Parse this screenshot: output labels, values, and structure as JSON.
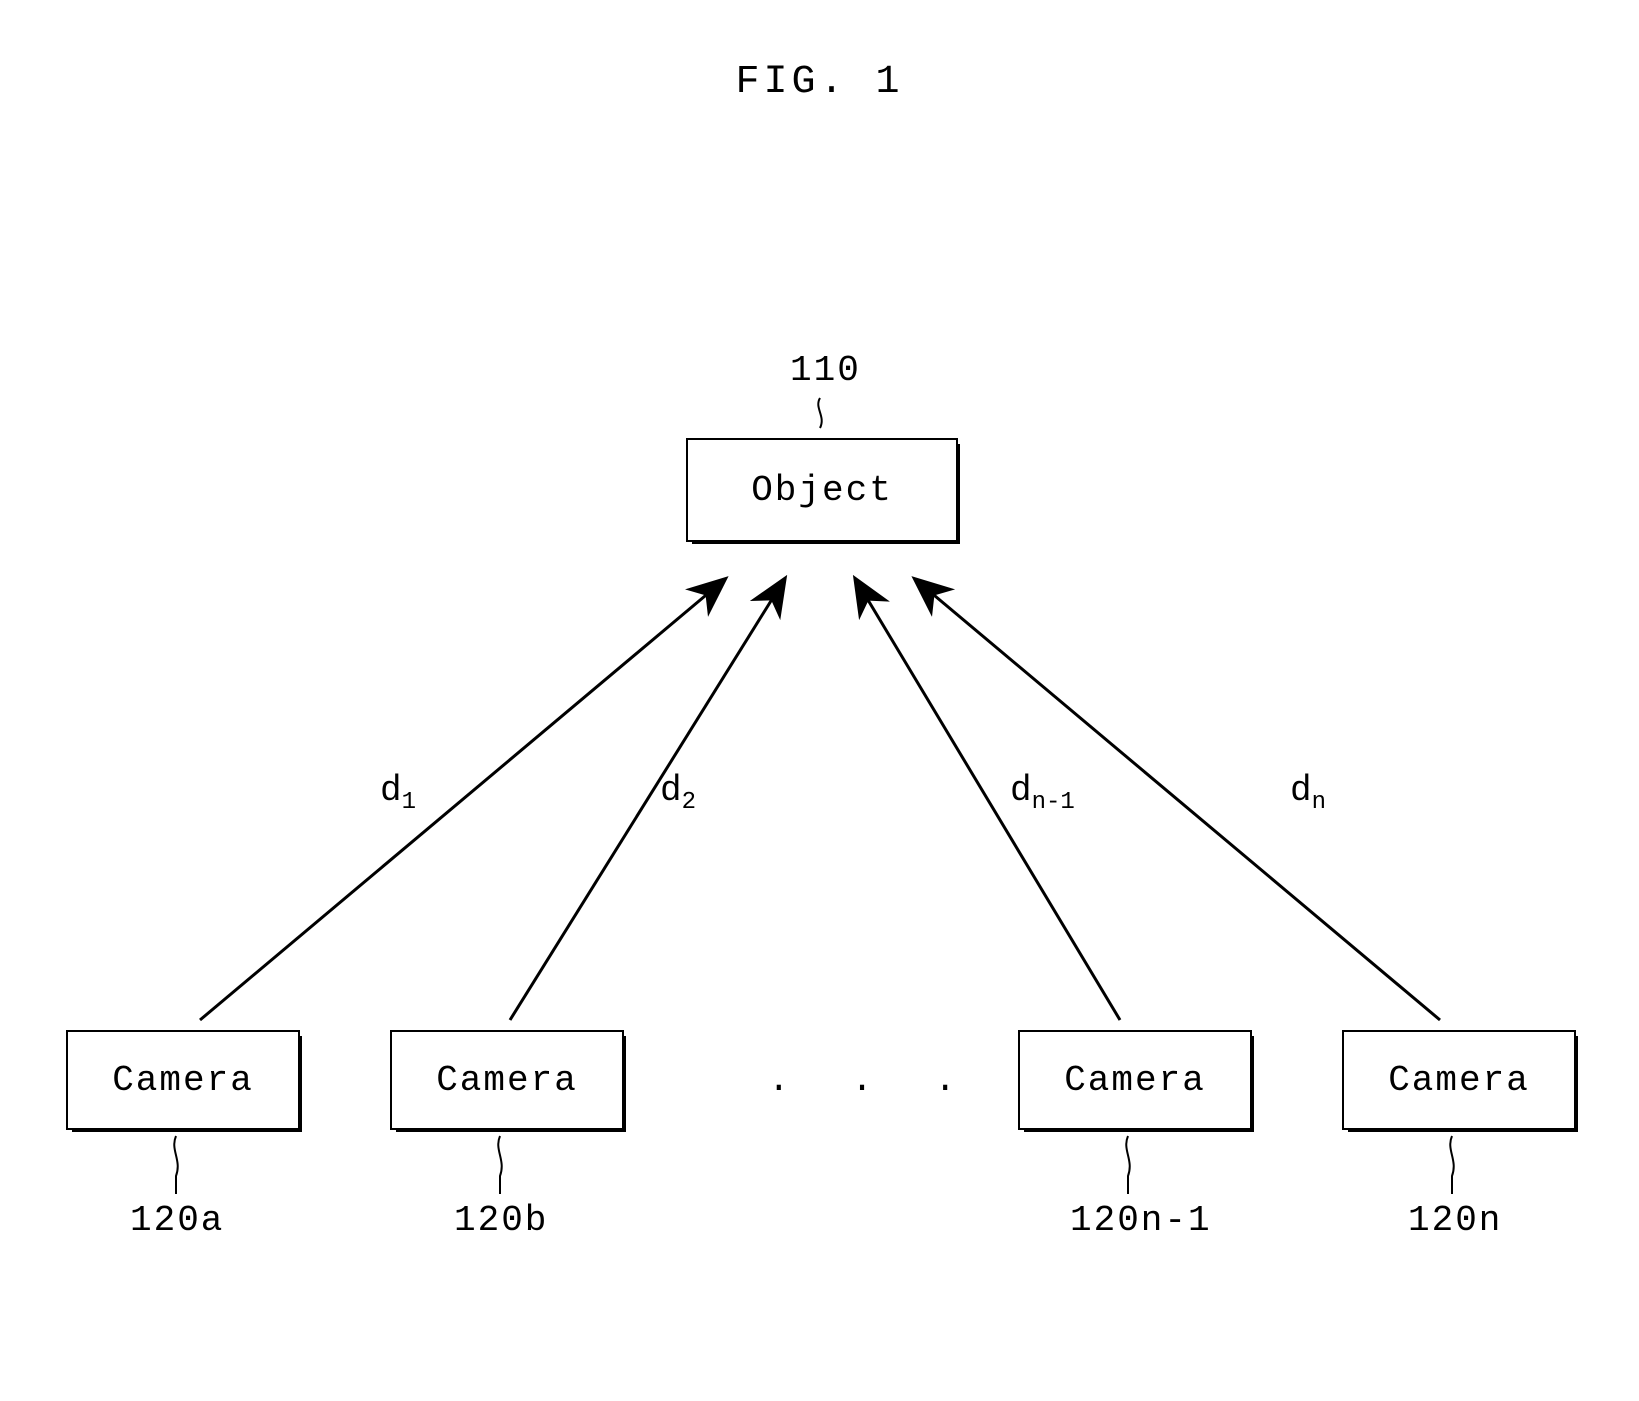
{
  "title": "FIG. 1",
  "object": {
    "label": "Object",
    "ref": "110"
  },
  "cameras": [
    {
      "label": "Camera",
      "ref": "120a",
      "d_html": "d<sub>1</sub>"
    },
    {
      "label": "Camera",
      "ref": "120b",
      "d_html": "d<sub>2</sub>"
    },
    {
      "label": "Camera",
      "ref": "120n-1",
      "d_html": "d<sub>n-1</sub>"
    },
    {
      "label": "Camera",
      "ref": "120n",
      "d_html": "d<sub>n</sub>"
    }
  ],
  "ellipsis": ". . ."
}
